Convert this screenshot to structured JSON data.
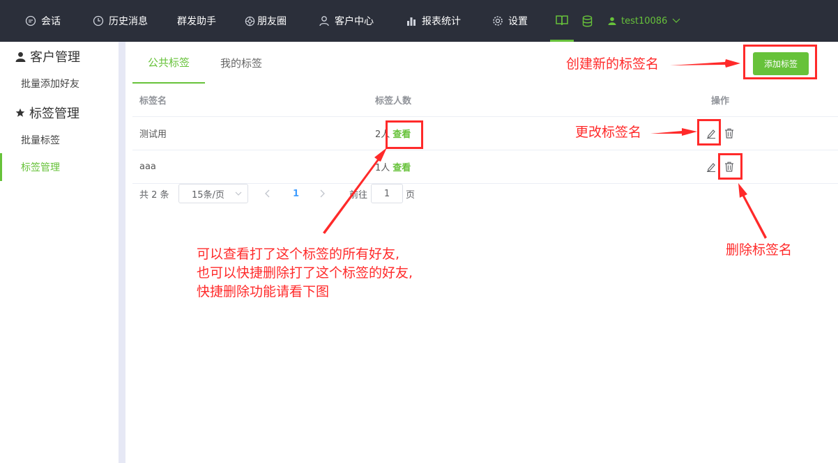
{
  "nav": {
    "items": [
      {
        "label": "会话",
        "icon": "chat-bubble-icon"
      },
      {
        "label": "历史消息",
        "icon": "clock-icon"
      },
      {
        "label": "群发助手",
        "icon": ""
      },
      {
        "label": "朋友圈",
        "icon": "aperture-icon"
      },
      {
        "label": "客户中心",
        "icon": "user-icon"
      },
      {
        "label": "报表统计",
        "icon": "bar-chart-icon"
      },
      {
        "label": "设置",
        "icon": "gear-icon"
      }
    ],
    "username": "test10086",
    "accent": "#67c23a",
    "background": "#2b2f3a"
  },
  "sidebar": {
    "group1": "客户管理",
    "group1_items": [
      "批量添加好友"
    ],
    "group2": "标签管理",
    "group2_items": [
      "批量标签",
      "标签管理"
    ],
    "active_item": "标签管理"
  },
  "tabs": [
    "公共标签",
    "我的标签"
  ],
  "add_button": "添加标签",
  "table": {
    "columns": [
      "标签名",
      "标签人数",
      "操作"
    ],
    "rows": [
      {
        "name": "测试用",
        "count": "2人",
        "view": "查看"
      },
      {
        "name": "aaa",
        "count": "1人",
        "view": "查看"
      }
    ]
  },
  "pagination": {
    "total": "共 2 条",
    "page_size": "15条/页",
    "current_page": "1",
    "goto_label": "前往",
    "goto_value": "1",
    "page_suffix": "页"
  },
  "annotations": {
    "create": "创建新的标签名",
    "rename": "更改标签名",
    "delete": "删除标签名",
    "view_line1": "可以查看打了这个标签的所有好友,",
    "view_line2": "也可以快捷删除打了这个标签的好友,",
    "view_line3": "快捷删除功能请看下图",
    "color": "#ff2a2a"
  }
}
